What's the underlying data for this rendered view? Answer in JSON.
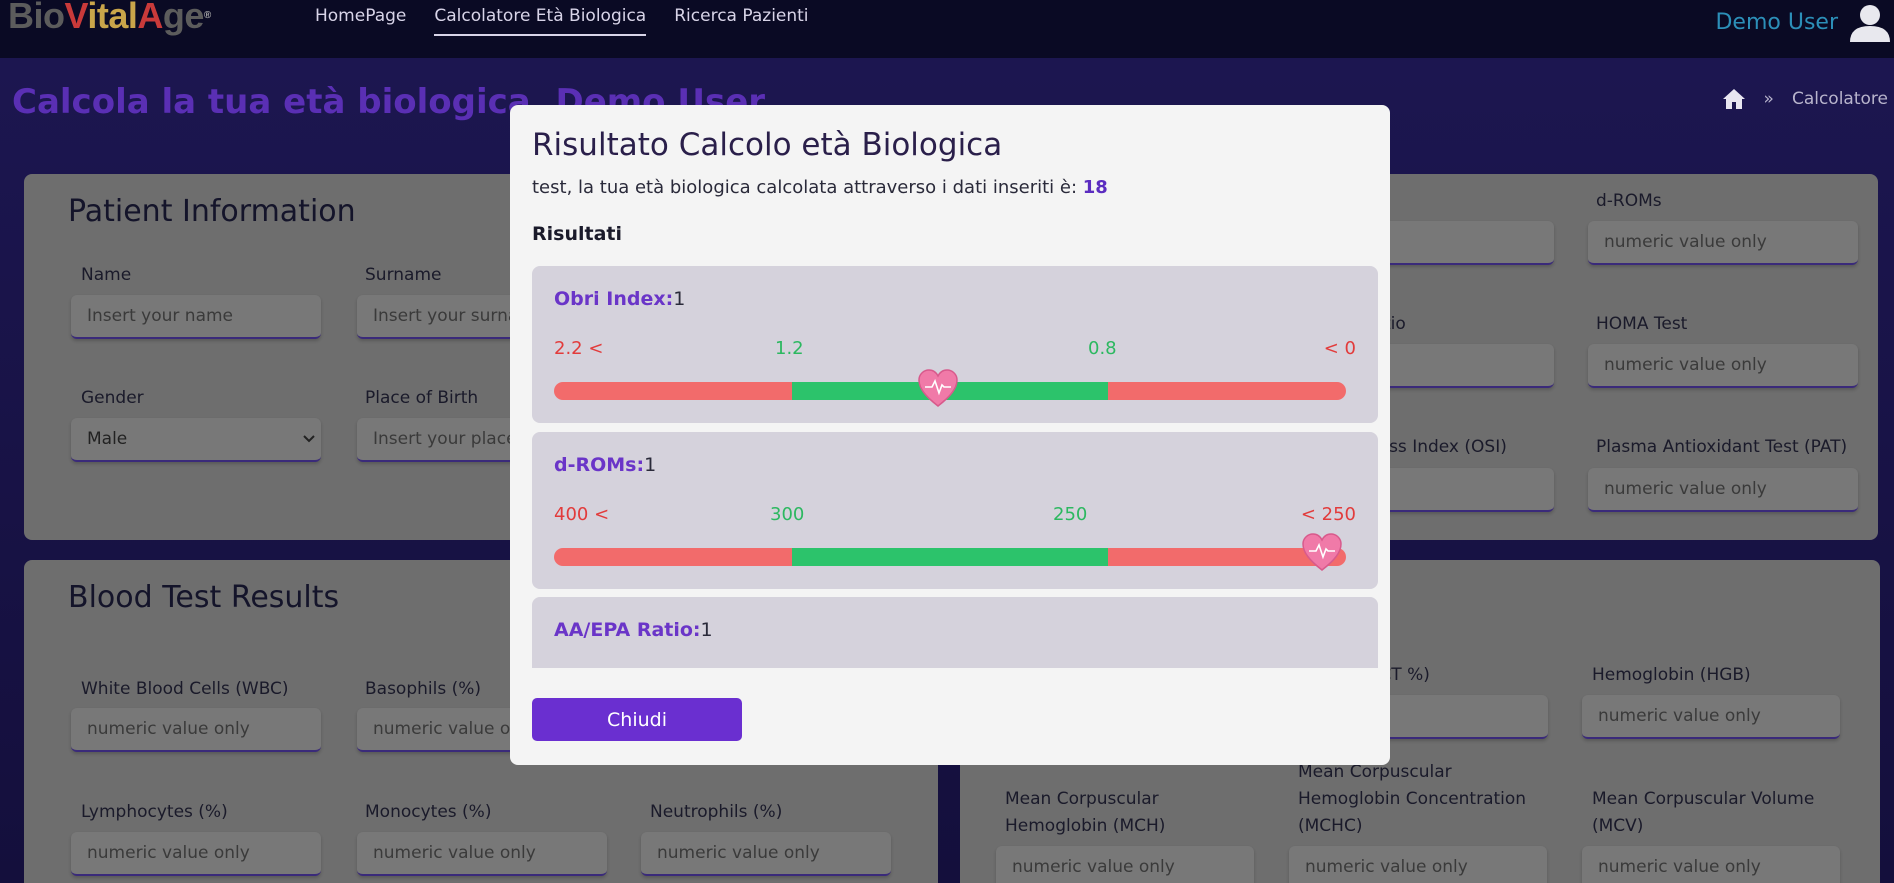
{
  "navbar": {
    "logo_parts": [
      "Bio",
      "V",
      "ital",
      "A",
      "ge"
    ],
    "logo_colors": [
      "#5c5c5c",
      "#c93a3a",
      "#c9a54a",
      "#c93a3a",
      "#5c5c5c"
    ],
    "links": [
      "HomePage",
      "Calcolatore Età Biologica",
      "Ricerca Pazienti"
    ],
    "active_link_index": 1,
    "user_name": "Demo User"
  },
  "page": {
    "title": "Calcola la tua età biologica, Demo User",
    "breadcrumb": {
      "separator": "»",
      "current": "Calcolatore"
    }
  },
  "patient_card": {
    "title": "Patient Information",
    "name_label": "Name",
    "name_placeholder": "Insert your name",
    "surname_label": "Surname",
    "surname_placeholder": "Insert your surna",
    "gender_label": "Gender",
    "gender_value": "Male",
    "birth_label": "Place of Birth",
    "birth_placeholder": "Insert your place"
  },
  "right_top_card": {
    "droms_label": "d-ROMs",
    "ratio_label_partial": "tio",
    "homa_label": "HOMA Test",
    "osi_label_partial": "ress Index (OSI)",
    "pat_label": "Plasma Antioxidant Test (PAT)",
    "partial_placeholder": "lue only",
    "placeholder": "numeric value only"
  },
  "blood_card": {
    "title": "Blood Test Results",
    "wbc_label": "White Blood Cells (WBC)",
    "baso_label": "Basophils (%)",
    "baso_placeholder_partial": "numeric value on",
    "lymph_label": "Lymphocytes (%)",
    "mono_label": "Monocytes (%)",
    "neut_label": "Neutrophils (%)",
    "placeholder": "numeric value only"
  },
  "right_bottom_card": {
    "hct_label_partial": "(HCT %)",
    "hgb_label": "Hemoglobin (HGB)",
    "mch_label": "Mean Corpuscular Hemoglobin (MCH)",
    "mchc_label": "Mean Corpuscular Hemoglobin Concentration (MCHC)",
    "mcv_label": "Mean Corpuscular Volume (MCV)",
    "partial_placeholder": "lue only",
    "placeholder": "numeric value only"
  },
  "modal": {
    "title": "Risultato Calcolo età Biologica",
    "subtitle_prefix": "test, la tua età biologica calcolata attraverso i dati inseriti è:",
    "age": "18",
    "section_title": "Risultati",
    "close_label": "Chiudi",
    "results": [
      {
        "name": "Obri Index:",
        "value": "1",
        "ticks": [
          "2.2 <",
          "1.2",
          "0.8",
          "< 0"
        ],
        "marker_fraction": 0.485
      },
      {
        "name": "d-ROMs:",
        "value": "1",
        "ticks": [
          "400 <",
          "300",
          "250",
          "< 250"
        ],
        "marker_fraction": 0.97
      },
      {
        "name": "AA/EPA Ratio:",
        "value": "1",
        "ticks": [],
        "marker_fraction": null
      }
    ],
    "colors": {
      "bad": "#f26b6b",
      "good": "#2cc36b",
      "accent": "#6a35c8"
    }
  }
}
